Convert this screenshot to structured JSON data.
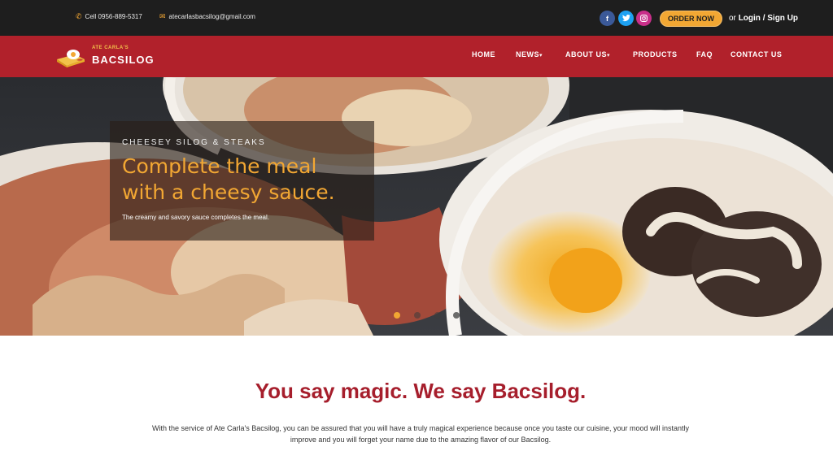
{
  "topbar": {
    "phone": "Cell 0956-889-5317",
    "email": "atecarlasbacsilog@gmail.com",
    "social": [
      "facebook-icon",
      "twitter-icon",
      "instagram-icon"
    ],
    "order_button": "ORDER NOW",
    "or_text": "or",
    "login": "Login",
    "separator": "/",
    "signup": "Sign Up"
  },
  "brand": {
    "small": "ATE CARLA'S",
    "name": "BACSILOG"
  },
  "nav": {
    "home": "HOME",
    "news": "NEWS",
    "about": "ABOUT US",
    "products": "PRODUCTS",
    "faq": "FAQ",
    "contact": "CONTACT US",
    "caret": "▾"
  },
  "hero": {
    "eyebrow": "CHEESEY SILOG & STEAKS",
    "title": "Complete the meal with a cheesy sauce.",
    "text": "The creamy and savory sauce completes the meal.",
    "active_slide": 1,
    "slide_count": 4
  },
  "intro": {
    "headline": "You say magic. We say Bacsilog.",
    "body": "With the service of Ate Carla's Bacsilog, you can be assured that you will have a truly magical experience because once you taste our cuisine, your mood will instantly improve and you will forget your name due to the amazing flavor of our Bacsilog."
  },
  "colors": {
    "topbar": "#1e1e1e",
    "nav": "#b1212b",
    "accent": "#f2a733",
    "headline": "#a61e2c"
  }
}
